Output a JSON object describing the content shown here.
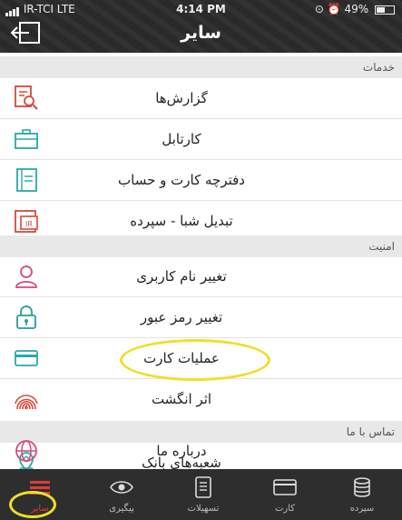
{
  "status_bar": {
    "carrier": "IR-TCI  LTE",
    "time": "4:14 PM",
    "battery": "49%",
    "battery_level": 0.49
  },
  "header": {
    "title": "سایر"
  },
  "sections": [
    {
      "title": "خدمات",
      "items": [
        {
          "label": "گزارش‌ها",
          "icon": "report-search-icon"
        },
        {
          "label": "کارتابل",
          "icon": "briefcase-icon"
        },
        {
          "label": "دفترچه کارت و حساب",
          "icon": "address-book-icon"
        },
        {
          "label": "تبدیل شبا - سپرده",
          "icon": "iban-convert-icon"
        }
      ]
    },
    {
      "title": "امنیت",
      "items": [
        {
          "label": "تغییر نام کاربری",
          "icon": "user-icon"
        },
        {
          "label": "تغییر رمز عبور",
          "icon": "lock-icon"
        },
        {
          "label": "عملیات کارت",
          "icon": "credit-card-icon"
        },
        {
          "label": "اثر انگشت",
          "icon": "fingerprint-icon"
        }
      ]
    },
    {
      "title": "تماس با ما",
      "items": [
        {
          "label": "شعبه‌های بانک",
          "icon": "map-pin-icon"
        },
        {
          "label": "درباره ما",
          "icon": "globe-icon"
        }
      ]
    }
  ],
  "tabs": [
    {
      "label": "سایر",
      "icon": "menu-icon",
      "active": true
    },
    {
      "label": "پیگیری",
      "icon": "eye-icon",
      "active": false
    },
    {
      "label": "تسهیلات",
      "icon": "document-icon",
      "active": false
    },
    {
      "label": "کارت",
      "icon": "card-icon",
      "active": false
    },
    {
      "label": "سپرده",
      "icon": "coins-icon",
      "active": false
    }
  ],
  "colors": {
    "accent_red": "#e03a3a",
    "highlight_yellow": "#f0de2a",
    "icon_teal": "#2aa8a8",
    "icon_pink": "#d44a7a"
  }
}
